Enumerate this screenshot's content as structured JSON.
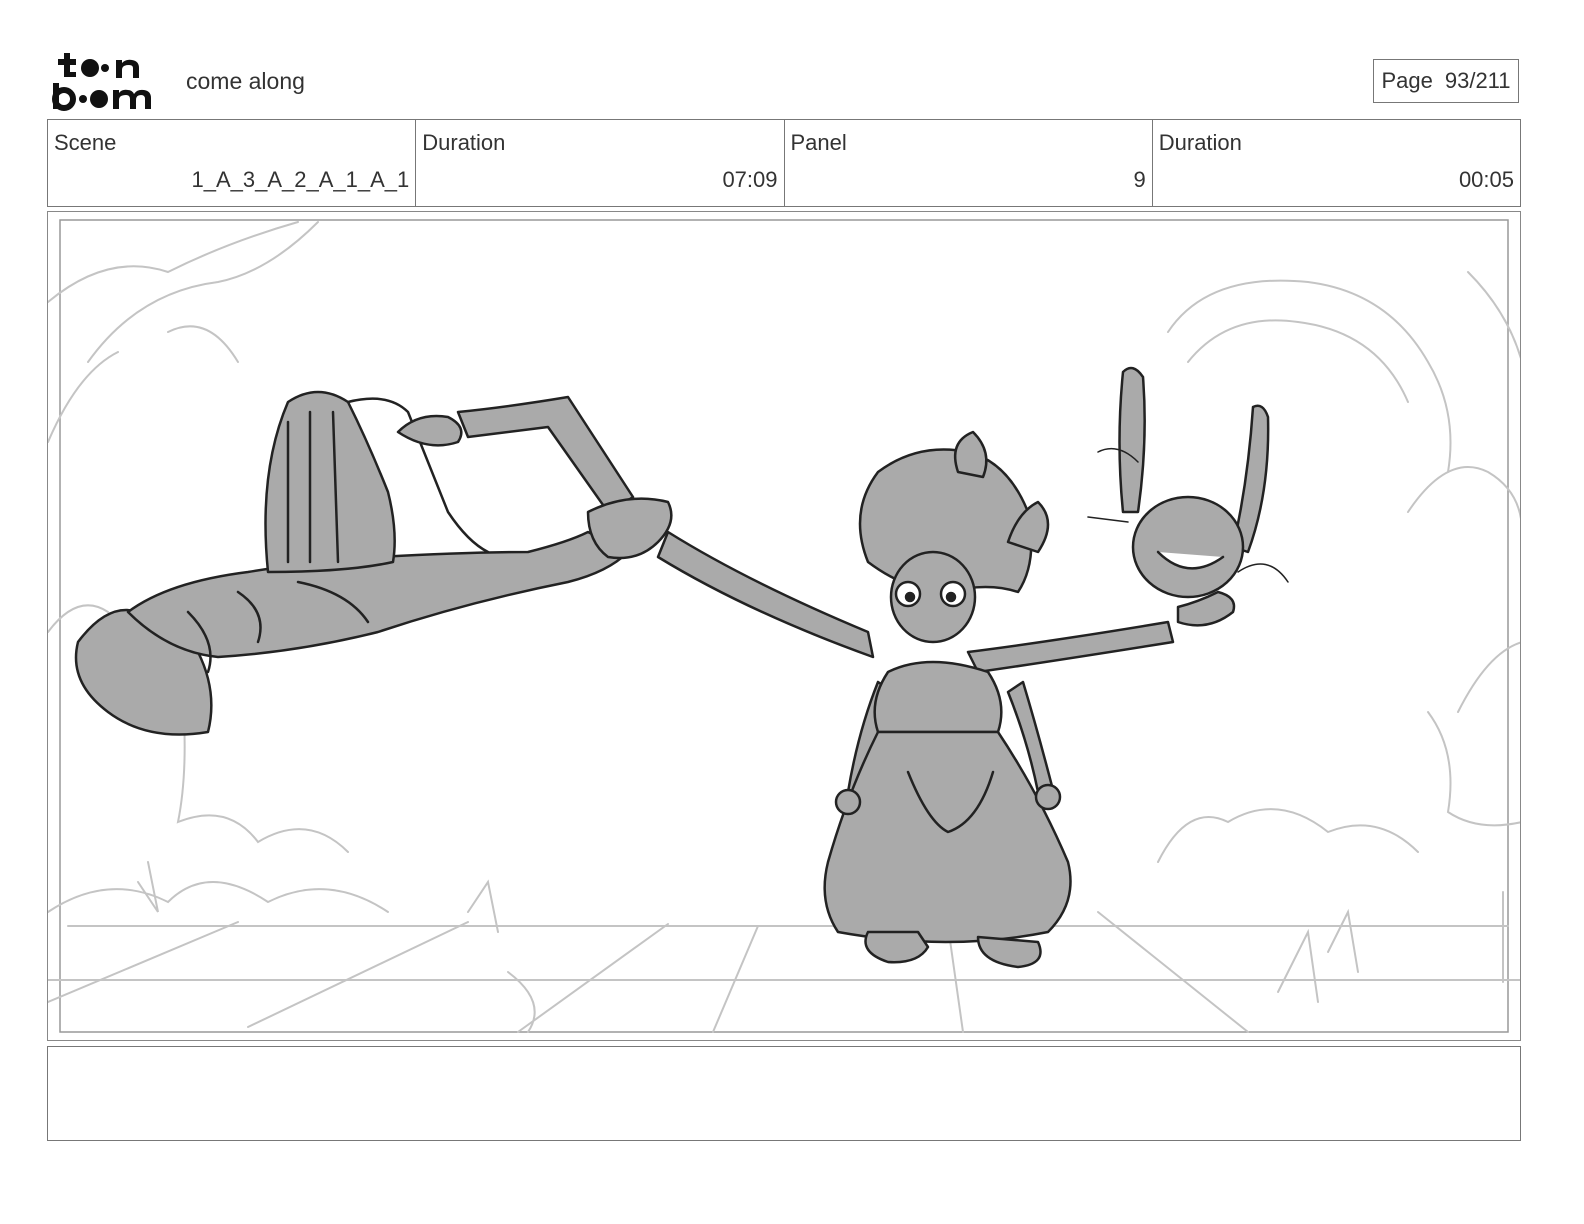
{
  "header": {
    "logo_icon": "toon-boom-logo",
    "project_title": "come along",
    "page_label": "Page",
    "page_number": "93/211"
  },
  "info": {
    "scene_label": "Scene",
    "scene_value": "1_A_3_A_2_A_1_A_1",
    "scene_duration_label": "Duration",
    "scene_duration_value": "07:09",
    "panel_label": "Panel",
    "panel_value": "9",
    "panel_duration_label": "Duration",
    "panel_duration_value": "00:05"
  },
  "panel": {
    "drawing_icon": "storyboard-sketch",
    "fill_color": "#aaaaaa",
    "line_color": "#222222",
    "background_line_color": "#c4c4c4"
  },
  "notes": {
    "text": ""
  }
}
